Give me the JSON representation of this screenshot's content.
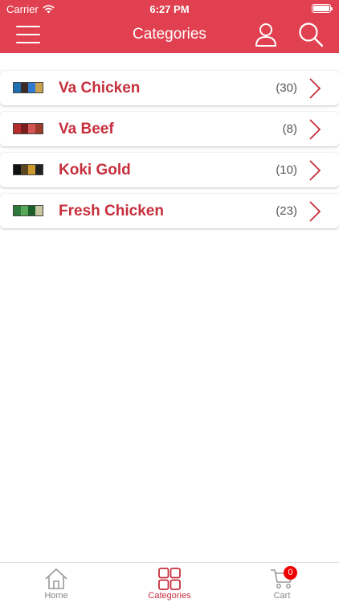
{
  "status_bar": {
    "carrier": "Carrier",
    "time": "6:27 PM"
  },
  "header": {
    "title": "Categories",
    "background_color": "#e0404f"
  },
  "categories": [
    {
      "name": "Va Chicken",
      "count": "(30)",
      "thumb_colors": [
        "#1f6fb3",
        "#3b2a25",
        "#2f7bd1",
        "#c9a24e"
      ]
    },
    {
      "name": "Va Beef",
      "count": "(8)",
      "thumb_colors": [
        "#b52c2c",
        "#7a1d1d",
        "#d15555",
        "#9c3a2b"
      ]
    },
    {
      "name": "Koki Gold",
      "count": "(10)",
      "thumb_colors": [
        "#111111",
        "#5a4620",
        "#cc9a2e",
        "#222222"
      ]
    },
    {
      "name": "Fresh Chicken",
      "count": "(23)",
      "thumb_colors": [
        "#2f7a3a",
        "#58a85a",
        "#1c5f2b",
        "#c6c6a0"
      ]
    }
  ],
  "tab_bar": {
    "home_label": "Home",
    "categories_label": "Categories",
    "cart_label": "Cart",
    "cart_count": "0",
    "active_color": "#c62f3c"
  }
}
